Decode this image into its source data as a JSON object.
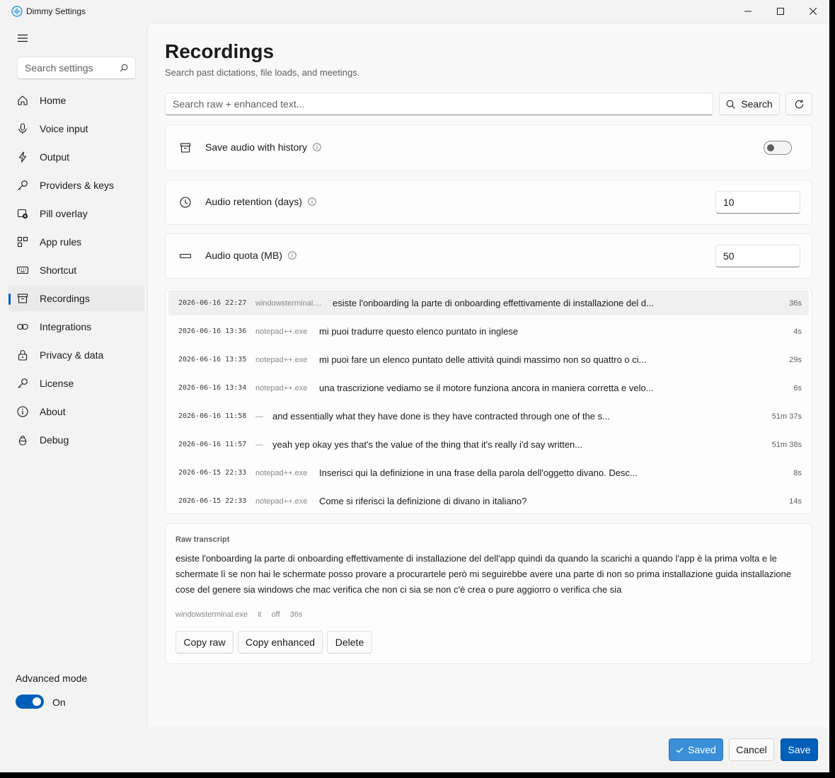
{
  "window": {
    "title": "Dimmy Settings"
  },
  "sidebar": {
    "search_placeholder": "Search settings",
    "items": [
      {
        "label": "Home",
        "icon": "home-icon"
      },
      {
        "label": "Voice input",
        "icon": "microphone-icon"
      },
      {
        "label": "Output",
        "icon": "bolt-icon"
      },
      {
        "label": "Providers & keys",
        "icon": "key-icon"
      },
      {
        "label": "Pill overlay",
        "icon": "overlay-icon"
      },
      {
        "label": "App rules",
        "icon": "app-rules-icon"
      },
      {
        "label": "Shortcut",
        "icon": "keyboard-icon"
      },
      {
        "label": "Recordings",
        "icon": "archive-icon",
        "active": true
      },
      {
        "label": "Integrations",
        "icon": "link-icon"
      },
      {
        "label": "Privacy & data",
        "icon": "lock-icon"
      },
      {
        "label": "License",
        "icon": "key-icon"
      },
      {
        "label": "About",
        "icon": "info-icon"
      },
      {
        "label": "Debug",
        "icon": "bug-icon"
      }
    ],
    "advanced": {
      "label": "Advanced mode",
      "state": "On"
    }
  },
  "page": {
    "title": "Recordings",
    "subtitle": "Search past dictations, file loads, and meetings.",
    "search_placeholder": "Search raw + enhanced text...",
    "search_button": "Search"
  },
  "settings": {
    "save_audio": {
      "label": "Save audio with history",
      "enabled": false
    },
    "retention": {
      "label": "Audio retention (days)",
      "value": "10"
    },
    "quota": {
      "label": "Audio quota (MB)",
      "value": "50"
    }
  },
  "recordings": [
    {
      "time": "2026-06-16 22:27",
      "app": "windowsterminal....",
      "text": "esiste l'onboarding la parte di onboarding effettivamente di installazione del d...",
      "duration": "36s"
    },
    {
      "time": "2026-06-16 13:36",
      "app": "notepad++.exe",
      "text": "mi puoi tradurre questo elenco puntato in inglese",
      "duration": "4s"
    },
    {
      "time": "2026-06-16 13:35",
      "app": "notepad++.exe",
      "text": "mi puoi fare un elenco puntato delle attività quindi massimo non so quattro o ci...",
      "duration": "29s"
    },
    {
      "time": "2026-06-16 13:34",
      "app": "notepad++.exe",
      "text": "una trascrizione vediamo se il motore funziona ancora in maniera corretta e velo...",
      "duration": "6s"
    },
    {
      "time": "2026-06-16 11:58",
      "app": "—",
      "text": "and essentially what they have done is they have contracted through one of the s...",
      "duration": "51m 37s"
    },
    {
      "time": "2026-06-16 11:57",
      "app": "—",
      "text": "yeah yep okay yes that's the value of the thing that it's really i'd say written...",
      "duration": "51m 38s"
    },
    {
      "time": "2026-06-15 22:33",
      "app": "notepad++.exe",
      "text": "Inserisci qui la definizione in una frase della parola dell'oggetto divano. Desc...",
      "duration": "8s"
    },
    {
      "time": "2026-06-15 22:33",
      "app": "notepad++.exe",
      "text": "Come si riferisci la definizione di divano in italiano?",
      "duration": "14s"
    }
  ],
  "detail": {
    "heading": "Raw transcript",
    "text": "esiste l'onboarding la parte di onboarding effettivamente di installazione del dell'app quindi da quando la scarichi a quando l'app è la prima volta e le schermate lì se non hai le schermate posso provare a procurartele però mi seguirebbe avere una parte di non so prima installazione guida installazione cose del genere sia windows che mac verifica che non ci sia se non c'è crea o pure aggiorro o verifica che sia",
    "meta": [
      "windowsterminal.exe",
      "it",
      "off",
      "36s"
    ],
    "copy_raw": "Copy raw",
    "copy_enhanced": "Copy enhanced",
    "delete": "Delete"
  },
  "footer": {
    "saved": "Saved",
    "cancel": "Cancel",
    "save": "Save"
  },
  "colors": {
    "accent": "#005fb8",
    "saved": "#3b8fd9"
  }
}
